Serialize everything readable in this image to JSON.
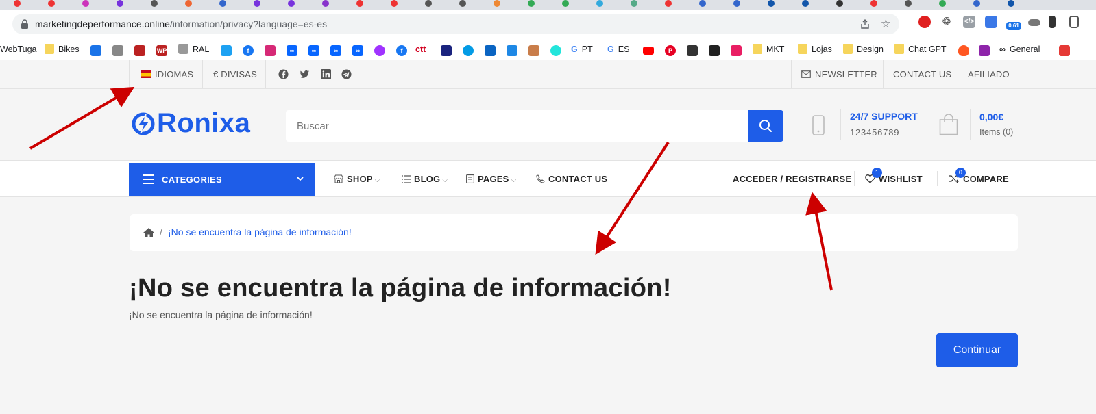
{
  "browser": {
    "url_host": "marketingdeperformance.online",
    "url_path": "/information/privacy?language=es-es",
    "bookmarks": [
      {
        "label": "WebTuga"
      },
      {
        "label": "Bikes"
      },
      {
        "label": "RAL"
      },
      {
        "label": "ctt"
      },
      {
        "label": "PT"
      },
      {
        "label": "ES"
      },
      {
        "label": "MKT"
      },
      {
        "label": "Lojas"
      },
      {
        "label": "Design"
      },
      {
        "label": "Chat GPT"
      },
      {
        "label": "General"
      }
    ],
    "extension_badge": "0.61"
  },
  "topbar": {
    "language": "IDIOMAS",
    "currency": "€ DIVISAS",
    "newsletter": "NEWSLETTER",
    "contact": "CONTACT US",
    "affiliate": "AFILIADO"
  },
  "header": {
    "logo_text": "Ronixa",
    "search_placeholder": "Buscar",
    "support_title": "24/7 SUPPORT",
    "support_phone": "123456789",
    "cart_amount": "0,00€",
    "cart_items": "Items (0)"
  },
  "nav": {
    "categories": "CATEGORIES",
    "shop": "SHOP",
    "blog": "BLOG",
    "pages": "PAGES",
    "contact": "CONTACT US",
    "login": "ACCEDER / REGISTRARSE",
    "wishlist": "WISHLIST",
    "wishlist_count": "1",
    "compare": "COMPARE",
    "compare_count": "0"
  },
  "content": {
    "breadcrumb_current": "¡No se encuentra la página de información!",
    "title": "¡No se encuentra la página de información!",
    "message": "¡No se encuentra la página de información!",
    "continue_label": "Continuar"
  },
  "colors": {
    "brand_blue": "#1e5de8",
    "annotation_red": "#cc0000"
  }
}
